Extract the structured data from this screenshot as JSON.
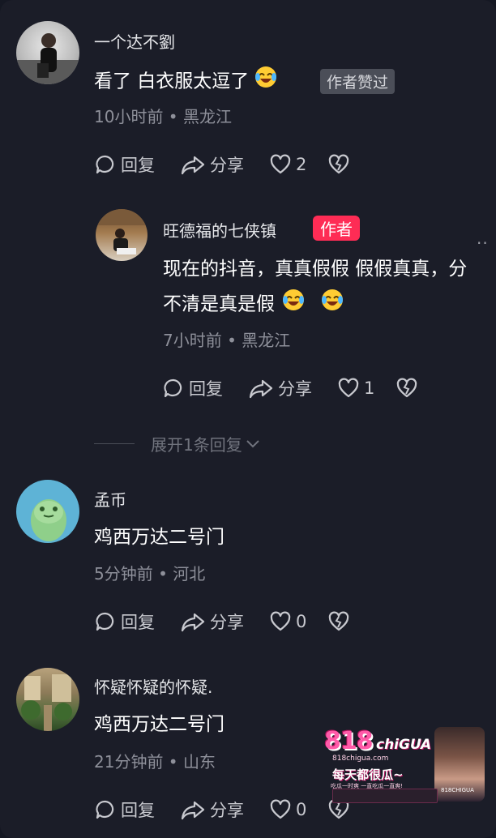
{
  "comments": [
    {
      "username": "一个达不劉",
      "text": "看了 白衣服太逗了",
      "liked_badge": "作者赞过",
      "time_location": "10小时前 • 黑龙江",
      "reply_label": "回复",
      "share_label": "分享",
      "like_count": "2"
    },
    {
      "username": "旺德福的七侠镇",
      "author_badge": "作者",
      "text_line1": "现在的抖音，真真假假 假假真真，分",
      "text_line2": "不清是真是假",
      "time_location": "7小时前 • 黑龙江",
      "reply_label": "回复",
      "share_label": "分享",
      "like_count": "1"
    },
    {
      "username": "孟币",
      "text": "鸡西万达二号门",
      "time_location": "5分钟前 • 河北",
      "reply_label": "回复",
      "share_label": "分享",
      "like_count": "0"
    },
    {
      "username": "怀疑怀疑的怀疑.",
      "text": "鸡西万达二号门",
      "time_location": "21分钟前 • 山东",
      "reply_label": "回复",
      "share_label": "分享",
      "like_count": "0"
    }
  ],
  "expand_replies": "展开1条回复",
  "more_dots": "··",
  "watermark": {
    "logo_number": "818",
    "logo_word": "chiGUA",
    "site": "818chigua.com",
    "slogan": "每天都很瓜~",
    "tagline": "吃瓜一时爽 一直吃瓜一直爽!",
    "side_text": "818CHIGUA"
  },
  "colors": {
    "background": "#1b1d28",
    "author_badge": "#fe2c55",
    "meta_text": "#8e909a",
    "action_text": "#c8c9cf"
  },
  "icons": [
    "comment-icon",
    "share-icon",
    "heart-icon",
    "broken-heart-icon",
    "chevron-down-icon",
    "laughing-emoji-icon"
  ]
}
